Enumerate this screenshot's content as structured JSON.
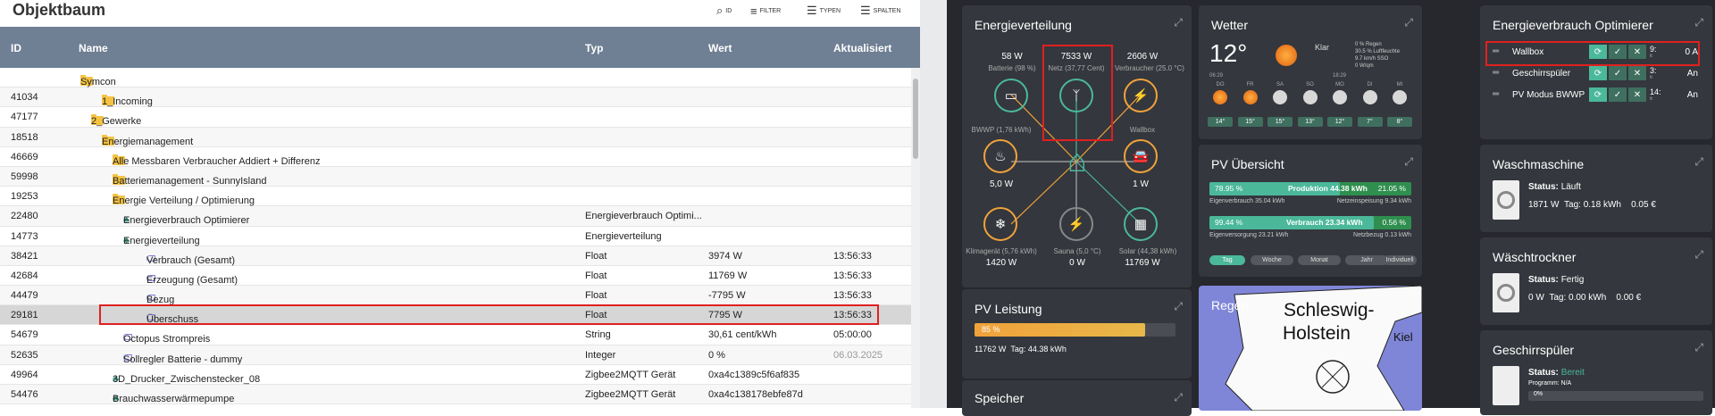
{
  "objektbaum": {
    "title": "Objektbaum",
    "toolbar": {
      "id": "ID",
      "filter": "FILTER",
      "typen": "TYPEN",
      "spalten": "SPALTEN"
    },
    "columns": {
      "id": "ID",
      "name": "Name",
      "typ": "Typ",
      "wert": "Wert",
      "aktualisiert": "Aktualisiert"
    },
    "rows": [
      {
        "id": "",
        "name": "Symcon",
        "typ": "",
        "wert": "",
        "akt": ""
      },
      {
        "id": "41034",
        "name": "1_Incoming",
        "typ": "",
        "wert": "",
        "akt": ""
      },
      {
        "id": "47177",
        "name": "2_Gewerke",
        "typ": "",
        "wert": "",
        "akt": ""
      },
      {
        "id": "18518",
        "name": "Energiemanagement",
        "typ": "",
        "wert": "",
        "akt": ""
      },
      {
        "id": "46669",
        "name": "Alle Messbaren Verbraucher Addiert + Differenz",
        "typ": "",
        "wert": "",
        "akt": ""
      },
      {
        "id": "59998",
        "name": "Batteriemanagement - SunnyIsland",
        "typ": "",
        "wert": "",
        "akt": ""
      },
      {
        "id": "19253",
        "name": "Energie Verteilung / Optimierung",
        "typ": "",
        "wert": "",
        "akt": ""
      },
      {
        "id": "22480",
        "name": "Energieverbrauch Optimierer",
        "typ": "Energieverbrauch Optimi...",
        "wert": "",
        "akt": ""
      },
      {
        "id": "14773",
        "name": "Energieverteilung",
        "typ": "Energieverteilung",
        "wert": "",
        "akt": ""
      },
      {
        "id": "38421",
        "name": "Verbrauch (Gesamt)",
        "typ": "Float",
        "wert": "3974 W",
        "akt": "13:56:33"
      },
      {
        "id": "42684",
        "name": "Erzeugung (Gesamt)",
        "typ": "Float",
        "wert": "11769 W",
        "akt": "13:56:33"
      },
      {
        "id": "44479",
        "name": "Bezug",
        "typ": "Float",
        "wert": "-7795 W",
        "akt": "13:56:33"
      },
      {
        "id": "29181",
        "name": "Überschuss",
        "typ": "Float",
        "wert": "7795 W",
        "akt": "13:56:33"
      },
      {
        "id": "54679",
        "name": "Octopus Strompreis",
        "typ": "String",
        "wert": "30,61 cent/kWh",
        "akt": "05:00:00"
      },
      {
        "id": "52635",
        "name": "Sollregler Batterie - dummy",
        "typ": "Integer",
        "wert": "0 %",
        "akt": "06.03.2025"
      },
      {
        "id": "49964",
        "name": "3D_Drucker_Zwischenstecker_08",
        "typ": "Zigbee2MQTT Gerät",
        "wert": "0xa4c1389c5f6af835",
        "akt": ""
      },
      {
        "id": "54476",
        "name": "Brauchwasserwärmepumpe",
        "typ": "Zigbee2MQTT Gerät",
        "wert": "0xa4c138178ebfe87d",
        "akt": ""
      }
    ]
  },
  "energie": {
    "title": "Energieverteilung",
    "batt_val": "58 W",
    "batt_lbl": "Batterie (98 %)",
    "netz_val": "7533 W",
    "netz_lbl": "Netz (37,77 Cent)",
    "verb_val": "2606 W",
    "verb_lbl": "Verbraucher (25.0 °C)",
    "bwwp_lbl": "BWWP (1,76 kWh)",
    "bwwp_val": "5,0 W",
    "wallbox_lbl": "Wallbox",
    "wallbox_val": "1 W",
    "klima_lbl": "Klimagerät (5,76 kWh)",
    "klima_val": "1420 W",
    "sauna_lbl": "Sauna (5,0 °C)",
    "sauna_val": "0 W",
    "solar_lbl": "Solar (44,38 kWh)",
    "solar_val": "11769 W"
  },
  "wetter": {
    "title": "Wetter",
    "temp": "12°",
    "cond": "Klar",
    "details": [
      "0 % Regen",
      "30.5 % Luftfeuchte",
      "9.7 km/h SSO",
      "0 W/qm"
    ],
    "sunrise": "06:29",
    "sunset": "18:29",
    "days": [
      "DO",
      "FR",
      "SA",
      "SO",
      "MO",
      "DI",
      "MI"
    ],
    "temps": [
      "14°",
      "15°",
      "15°",
      "13°",
      "12°",
      "7°",
      "8°"
    ]
  },
  "optimierer": {
    "title": "Energieverbrauch Optimierer",
    "items": [
      {
        "name": "Wallbox",
        "t1": "9:",
        "t2": "tt",
        "val": "0 A"
      },
      {
        "name": "Geschirrspüler",
        "t1": "3:",
        "t2": "tt",
        "val": "An"
      },
      {
        "name": "PV Modus BWWP",
        "t1": "14:",
        "t2": "tt",
        "val": "An"
      }
    ]
  },
  "pv": {
    "title": "PV Übersicht",
    "p1": "78.95 %",
    "p1_mid": "Produktion 44.38 kWh",
    "p1_right": "21.05 %",
    "l1": "Eigenverbrauch 35.04 kWh",
    "r1": "Netzeinspeisung 9.34 kWh",
    "p2": "99.44 %",
    "p2_mid": "Verbrauch 23.34 kWh",
    "p2_right": "0.56 %",
    "l2": "Eigenversorgung 23.21 kWh",
    "r2": "Netzbezug 0.13 kWh",
    "tabs": [
      "Tag",
      "Woche",
      "Monat",
      "Jahr",
      "Individuell"
    ],
    "production_share": 0.7895,
    "consumption_share": 0.9944
  },
  "pvleistung": {
    "title": "PV Leistung",
    "pct": "85 %",
    "level": 0.85,
    "watts": "11762 W",
    "tag": "Tag: 44.38 kWh"
  },
  "regen": {
    "title": "Regen",
    "map1": "Schleswig-",
    "map2": "Holstein",
    "map3": "Kiel"
  },
  "waschmaschine": {
    "title": "Waschmaschine",
    "status_lbl": "Status:",
    "status": "Läuft",
    "w": "1871 W",
    "tag": "Tag: 0.18 kWh",
    "eur": "0.05 €"
  },
  "waeschetrockner": {
    "title": "Wäschtrockner",
    "status_lbl": "Status:",
    "status": "Fertig",
    "w": "0 W",
    "tag": "Tag: 0.00 kWh",
    "eur": "0.00 €"
  },
  "geschirr": {
    "title": "Geschirrspüler",
    "status_lbl": "Status:",
    "status": "Bereit",
    "prog": "Programm: N/A",
    "pct": "0%"
  },
  "speicher": {
    "title": "Speicher"
  },
  "colors": {
    "green": "#4bb89a",
    "orange": "#f0a23b",
    "red": "#e02020",
    "header": "#6f7f94"
  }
}
